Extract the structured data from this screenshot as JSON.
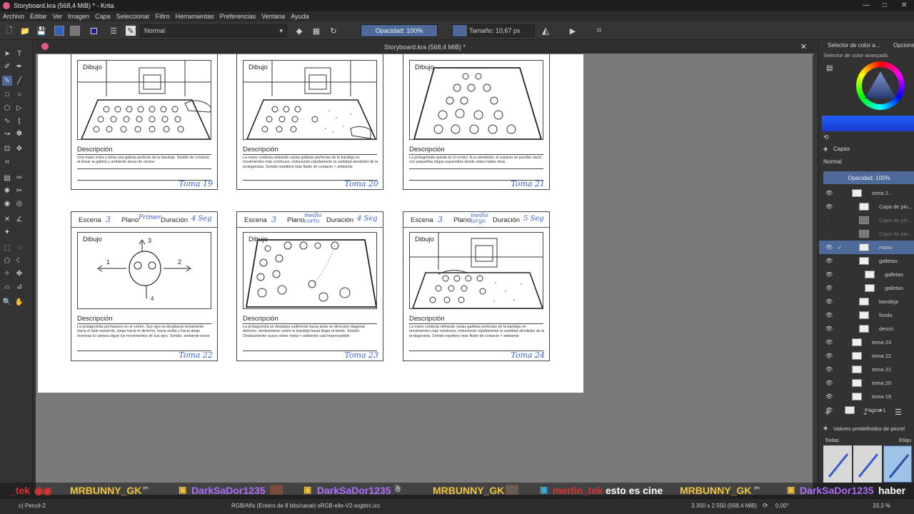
{
  "window": {
    "title": "Storyboard.kra (568,4 MiB) * - Krita",
    "controls": [
      "—",
      "□",
      "✕"
    ]
  },
  "menu": [
    "Archivo",
    "Editar",
    "Ver",
    "Imagen",
    "Capa",
    "Seleccionar",
    "Filtro",
    "Herramientas",
    "Preferencias",
    "Ventana",
    "Ayuda"
  ],
  "toolbar": {
    "blend_mode": "Normal",
    "opacity": "Opacidad: 100%",
    "size": "Tamaño: 10,67 px"
  },
  "document_tab": {
    "title": "Storyboard.kra (568,4 MiB) *",
    "close": "✕"
  },
  "storyboard": {
    "row1": [
      {
        "dibujo": "Dibujo",
        "desc_title": "Descripción",
        "desc": "Una mano entra y toma una galleta perfecta de la bandeja. Sonido de contacto al tomar la galleta y ambiente tenue de cocina",
        "toma": "Toma 19"
      },
      {
        "dibujo": "Dibujo",
        "desc_title": "Descripción",
        "desc": "La mano continúa retirando varias galletas perfectas de la bandeja en movimientos más continuos, reduciendo rápidamente la cantidad alrededor de la protagonista. Sonido repetitivo más fluido de contacto + ambiente",
        "toma": "Toma 20"
      },
      {
        "dibujo": "Dibujo",
        "desc_title": "Descripción",
        "desc": "La protagonista queda en el centro. A su alrededor, el espacio se percibe vacío, con pequeñas migas esparcidas donde antes había otras.",
        "toma": "Toma 21"
      }
    ],
    "row2": [
      {
        "escena": "Escena",
        "escena_num": "3",
        "plano": "Plano",
        "plano_val": "Primer",
        "duracion": "Duración",
        "dur_val": "4 Seg",
        "dibujo": "Dibujo",
        "desc_title": "Descripción",
        "desc": "La protagonista permanece en el centro. Sus ojos se desplazan lentamente hacia el lado izquierdo, luego hacia el derecho, hacia arriba y hacia abajo mientras la cámara sigue los movimientos de sus ojos. Sonido: ambiente tenue",
        "toma": "Toma 22",
        "arrows": {
          "up": "3",
          "left": "1",
          "right": "2",
          "down": "4"
        }
      },
      {
        "escena": "Escena",
        "escena_num": "3",
        "plano": "Plano",
        "plano_val": "medio corto",
        "duracion": "Duración",
        "dur_val": "4 Seg",
        "dibujo": "Dibujo",
        "desc_title": "Descripción",
        "desc": "La protagonista se desplaza sutilmente hacia atrás en dirección diagonal derecho, deslizándose sobre la bandeja hasta llegar al borde. Sonido: Deslizamiento suave sobre metal + ambiente casi imperceptible",
        "toma": "Toma 23"
      },
      {
        "escena": "Escena",
        "escena_num": "3",
        "plano": "Plano",
        "plano_val": "medio largo",
        "duracion": "Duración",
        "dur_val": "5 Seg",
        "dibujo": "Dibujo",
        "desc_title": "Descripción",
        "desc": "La mano continúa retirando varias galletas perfectas de la bandeja en movimientos más continuos, reduciendo rápidamente la cantidad alrededor de la protagonista. Sonido repetitivo más fluido de contacto + ambiente",
        "toma": "Toma 24"
      }
    ]
  },
  "right_panel": {
    "tabs": [
      "Selector de color a...",
      "Opcione"
    ],
    "color_selector": "Selector de color avanzado",
    "layers_title": "Capas",
    "layers_mode": "Normal",
    "layers_opacity": "Opacidad:  100%",
    "layers": [
      {
        "name": "toma 2..."
      },
      {
        "name": "Capa de pin..."
      },
      {
        "name": "Capa de pin..."
      },
      {
        "name": "Capa de pin..."
      },
      {
        "name": "mano"
      },
      {
        "name": "galletas"
      },
      {
        "name": "galletas"
      },
      {
        "name": "galletas"
      },
      {
        "name": "bandeja"
      },
      {
        "name": "fondo"
      },
      {
        "name": "descri"
      },
      {
        "name": "toma 23"
      },
      {
        "name": "toma 22"
      },
      {
        "name": "toma 21"
      },
      {
        "name": "toma 20"
      },
      {
        "name": "toma 19"
      },
      {
        "name": "Página 1"
      }
    ],
    "brush_presets": "Valores predefinidos de pincel",
    "brush_filter": "Todas",
    "brush_tag": "Etiqu"
  },
  "chat": [
    {
      "user": "_tek",
      "text": ""
    },
    {
      "user": "MRBUNNY_GK",
      "text": ""
    },
    {
      "user": "DarkSaDor1235",
      "text": ""
    },
    {
      "user": "DarkSaDor1235",
      "text": ""
    },
    {
      "user": "MRBUNNY_GK",
      "text": ""
    },
    {
      "user": "merlin_tek",
      "text": "esto es cine"
    },
    {
      "user": "MRBUNNY_GK",
      "text": ""
    },
    {
      "user": "DarkSaDor1235",
      "text": "haber"
    }
  ],
  "status": {
    "brush": "c) Pencil-2",
    "colorspace": "RGB/Alfa (Entero de 8 bits/canal)  sRGB-elle-V2-srgbtrc.icc",
    "dims": "3.300 x 2.550 (568,4 MiB)",
    "rotation": "0,00°",
    "zoom": "33,3 %"
  },
  "colors": {
    "accent": "#3a5fcd",
    "chat_user_yellow": "#f0c43a",
    "chat_user_purple": "#b06bff",
    "chat_user_red": "#e03030"
  }
}
